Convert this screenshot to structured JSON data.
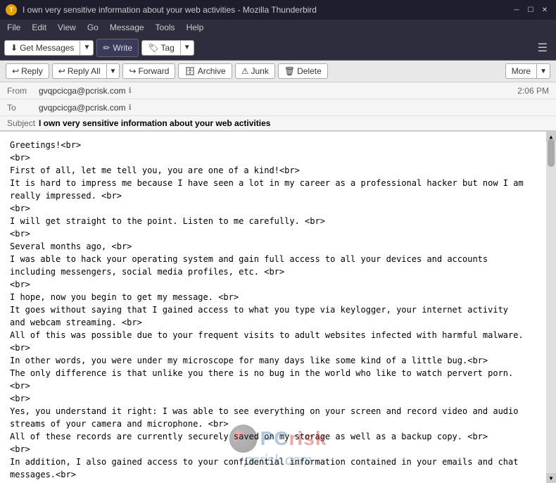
{
  "window": {
    "title": "I own very sensitive information about your web activities - Mozilla Thunderbird",
    "icon": "T"
  },
  "menu": {
    "items": [
      "File",
      "Edit",
      "View",
      "Go",
      "Message",
      "Tools",
      "Help"
    ]
  },
  "toolbar": {
    "get_messages_label": "Get Messages",
    "write_label": "Write",
    "tag_label": "Tag"
  },
  "action_bar": {
    "reply_label": "Reply",
    "reply_all_label": "Reply All",
    "forward_label": "Forward",
    "archive_label": "Archive",
    "junk_label": "Junk",
    "delete_label": "Delete",
    "more_label": "More"
  },
  "email": {
    "from_label": "From",
    "from_address": "gvqpcicga@pcrisk.com",
    "to_label": "To",
    "to_address": "gvqpcicga@pcrisk.com",
    "time": "2:06 PM",
    "subject_label": "Subject",
    "subject": "I own very sensitive information about your web activities",
    "body": "Greetings!<br>\n<br>\nFirst of all, let me tell you, you are one of a kind!<br>\nIt is hard to impress me because I have seen a lot in my career as a professional hacker but now I am\nreally impressed. <br>\n<br>\nI will get straight to the point. Listen to me carefully. <br>\n<br>\nSeveral months ago, <br>\nI was able to hack your operating system and gain full access to all your devices and accounts\nincluding messengers, social media profiles, etc. <br>\n<br>\nI hope, now you begin to get my message. <br>\nIt goes without saying that I gained access to what you type via keylogger, your internet activity\nand webcam streaming. <br>\nAll of this was possible due to your frequent visits to adult websites infected with harmful malware.\n<br>\nIn other words, you were under my microscope for many days like some kind of a little bug.<br>\nThe only difference is that unlike you there is no bug in the world who like to watch pervert porn.\n<br>\n<br>\nYes, you understand it right: I was able to see everything on your screen and record video and audio\nstreams of your camera and microphone. <br>\nAll of these records are currently securely saved on my storage as well as a backup copy. <br>\n<br>\nIn addition, I also gained access to your confidential information contained in your emails and chat\nmessages.<br>\nIf you are wondering why your antivirus and spyware defender software allowed me to do all of\nthat:<br>\n)"
  }
}
